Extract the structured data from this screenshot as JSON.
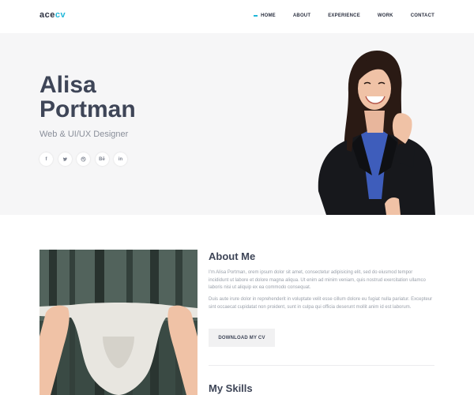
{
  "brand": {
    "logo_main": "ace",
    "logo_accent": "cv",
    "accent_color": "#1fb7d9"
  },
  "nav": {
    "items": [
      {
        "label": "HOME",
        "active": true
      },
      {
        "label": "ABOUT"
      },
      {
        "label": "EXPERIENCE"
      },
      {
        "label": "WORK"
      },
      {
        "label": "CONTACT"
      }
    ]
  },
  "hero": {
    "first_name": "Alisa",
    "last_name": "Portman",
    "title": "Web & UI/UX Designer",
    "socials": [
      {
        "icon": "facebook-icon",
        "glyph": "f"
      },
      {
        "icon": "twitter-icon",
        "glyph": "t"
      },
      {
        "icon": "dribbble-icon",
        "glyph": "◎"
      },
      {
        "icon": "behance-icon",
        "glyph": "Bē"
      },
      {
        "icon": "linkedin-icon",
        "glyph": "in"
      }
    ]
  },
  "about": {
    "heading": "About Me",
    "paragraph1": "I'm Alisa Portman, orem ipsum dolor sit amet, consectetur adipisicing elit, sed do eiusmod tempor incididunt ut labore et dolore magna aliqua. Ut enim ad minim veniam, quis nostrud exercitation ullamco laboris nisi ut aliquip ex ea commodo consequat.",
    "paragraph2": "Duis aute irure dolor in reprehenderit in voluptate velit esse cillum dolore eu fugiat nulla pariatur. Excepteur sint occaecat cupidatat non proident, sunt in culpa qui officia deserunt mollit anim id est laborum.",
    "download_label": "DOWNLOAD MY CV"
  },
  "skills": {
    "heading": "My Skills"
  }
}
